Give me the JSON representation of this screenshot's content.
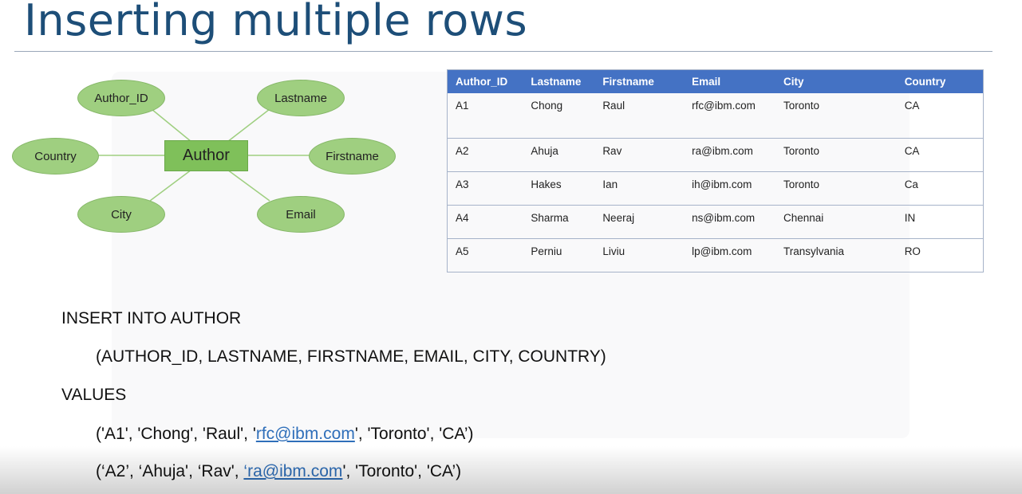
{
  "slide": {
    "title": "Inserting multiple rows"
  },
  "er_diagram": {
    "entity": "Author",
    "attributes": {
      "author_id": "Author_ID",
      "lastname": "Lastname",
      "country": "Country",
      "firstname": "Firstname",
      "city": "City",
      "email": "Email"
    }
  },
  "table": {
    "headers": [
      "Author_ID",
      "Lastname",
      "Firstname",
      "Email",
      "City",
      "Country"
    ],
    "rows": [
      [
        "A1",
        "Chong",
        "Raul",
        "rfc@ibm.com",
        "Toronto",
        "CA"
      ],
      [
        "A2",
        "Ahuja",
        "Rav",
        "ra@ibm.com",
        "Toronto",
        "CA"
      ],
      [
        "A3",
        "Hakes",
        "Ian",
        "ih@ibm.com",
        "Toronto",
        "Ca"
      ],
      [
        "A4",
        "Sharma",
        "Neeraj",
        "ns@ibm.com",
        "Chennai",
        "IN"
      ],
      [
        "A5",
        "Perniu",
        "Liviu",
        "lp@ibm.com",
        "Transylvania",
        "RO"
      ]
    ],
    "header_color": "#4472c4"
  },
  "sql": {
    "line1": "INSERT INTO AUTHOR",
    "line2": "(AUTHOR_ID, LASTNAME, FIRSTNAME, EMAIL, CITY, COUNTRY)",
    "line3": "VALUES",
    "values1": {
      "pre": "('A1', 'Chong', 'Raul', '",
      "email": "rfc@ibm.com",
      "post": "', 'Toronto', 'CA’)"
    },
    "values2": {
      "pre": "(‘A2’, ‘Ahuja', ‘Rav', ",
      "email": "‘ra@ibm.com",
      "post": "', 'Toronto', 'CA’)"
    }
  },
  "colors": {
    "title": "#1d4e78",
    "attribute_fill": "#9fcf80",
    "entity_fill": "#7fc05a",
    "link": "#2f6fba"
  }
}
